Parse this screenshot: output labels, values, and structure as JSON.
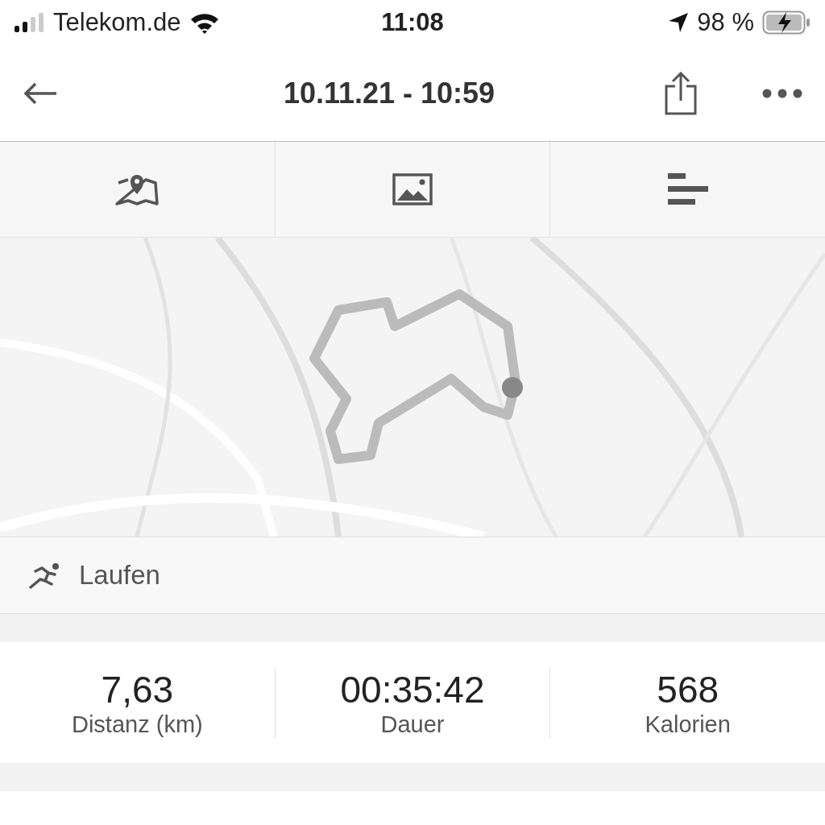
{
  "status_bar": {
    "carrier": "Telekom.de",
    "time": "11:08",
    "battery": "98 %"
  },
  "header": {
    "title": "10.11.21 - 10:59"
  },
  "tabs": [
    {
      "kind": "map"
    },
    {
      "kind": "photos"
    },
    {
      "kind": "stats"
    }
  ],
  "activity": {
    "label": "Laufen"
  },
  "stats": [
    {
      "value": "7,63",
      "label": "Distanz (km)"
    },
    {
      "value": "00:35:42",
      "label": "Dauer"
    },
    {
      "value": "568",
      "label": "Kalorien"
    }
  ]
}
